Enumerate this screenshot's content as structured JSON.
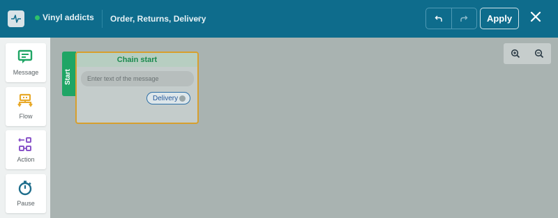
{
  "header": {
    "bot_name": "Vinyl addicts",
    "flow_title": "Order, Returns, Delivery",
    "apply_label": "Apply",
    "icons": [
      "app-logo-icon",
      "status-dot",
      "pencil-icon",
      "undo-icon",
      "redo-icon",
      "close-icon"
    ],
    "status_color": "#2ec16a",
    "bar_color": "#0e6c8c"
  },
  "palette": {
    "items": [
      {
        "label": "Message",
        "icon": "message-icon",
        "color": "#1fa565"
      },
      {
        "label": "Flow",
        "icon": "flow-icon",
        "color": "#e8a92a"
      },
      {
        "label": "Action",
        "icon": "action-icon",
        "color": "#8a55c9"
      },
      {
        "label": "Pause",
        "icon": "timer-icon",
        "color": "#1f6e8c"
      }
    ]
  },
  "canvas": {
    "zoom_icons": [
      "zoom-in-icon",
      "zoom-out-icon"
    ],
    "node": {
      "start_label": "Start",
      "title": "Chain start",
      "message_placeholder": "Enter text of the message",
      "button_label": "Delivery"
    }
  }
}
